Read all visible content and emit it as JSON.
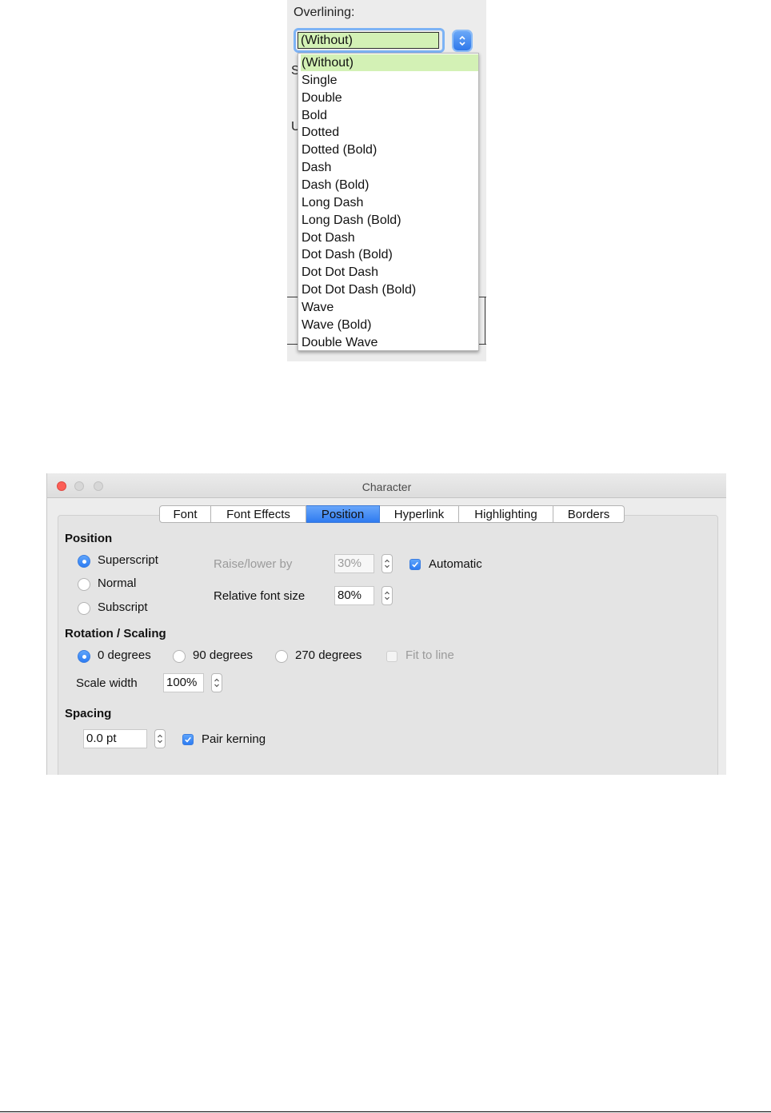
{
  "overlining_popup": {
    "label": "Overlining:",
    "selected_value": "(Without)",
    "options": [
      "(Without)",
      "Single",
      "Double",
      "Bold",
      "Dotted",
      "Dotted (Bold)",
      "Dash",
      "Dash (Bold)",
      "Long Dash",
      "Long Dash (Bold)",
      "Dot Dash",
      "Dot Dash (Bold)",
      "Dot Dot Dash",
      "Dot Dot Dash (Bold)",
      "Wave",
      "Wave (Bold)",
      "Double Wave"
    ],
    "highlight_color": "#d3f1b5"
  },
  "character_dialog": {
    "title": "Character",
    "tabs": [
      "Font",
      "Font Effects",
      "Position",
      "Hyperlink",
      "Highlighting",
      "Borders"
    ],
    "active_tab": "Position",
    "position": {
      "heading": "Position",
      "options": [
        "Superscript",
        "Normal",
        "Subscript"
      ],
      "selected": "Superscript",
      "raise_lower_label": "Raise/lower by",
      "raise_lower_value": "30%",
      "automatic_label": "Automatic",
      "automatic_checked": true,
      "relative_font_size_label": "Relative font size",
      "relative_font_size_value": "80%"
    },
    "rotation_scaling": {
      "heading": "Rotation / Scaling",
      "options": [
        "0 degrees",
        "90 degrees",
        "270 degrees"
      ],
      "selected": "0 degrees",
      "fit_to_line_label": "Fit to line",
      "fit_to_line_checked": false,
      "scale_width_label": "Scale width",
      "scale_width_value": "100%"
    },
    "spacing": {
      "heading": "Spacing",
      "value": "0.0 pt",
      "pair_kerning_label": "Pair kerning",
      "pair_kerning_checked": true
    },
    "accent_color": "#2f7bf0",
    "close_button_color": "#fc5f57"
  }
}
